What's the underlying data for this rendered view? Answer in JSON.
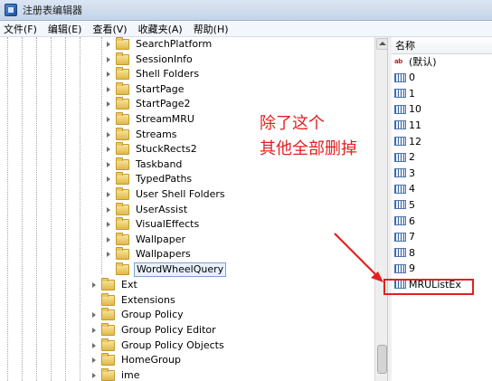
{
  "window": {
    "title": "注册表编辑器"
  },
  "menu": [
    "文件(F)",
    "编辑(E)",
    "查看(V)",
    "收藏夹(A)",
    "帮助(H)"
  ],
  "tree": {
    "child_items": [
      "SearchPlatform",
      "SessionInfo",
      "Shell Folders",
      "StartPage",
      "StartPage2",
      "StreamMRU",
      "Streams",
      "StuckRects2",
      "Taskband",
      "TypedPaths",
      "User Shell Folders",
      "UserAssist",
      "VisualEffects",
      "Wallpaper",
      "Wallpapers",
      "WordWheelQuery"
    ],
    "selected": "WordWheelQuery",
    "parent_items": [
      "Ext",
      "Extensions",
      "Group Policy",
      "Group Policy Editor",
      "Group Policy Objects",
      "HomeGroup",
      "ime"
    ]
  },
  "values": {
    "header": "名称",
    "items": [
      {
        "name": "(默认)",
        "type": "string"
      },
      {
        "name": "0",
        "type": "binary"
      },
      {
        "name": "1",
        "type": "binary"
      },
      {
        "name": "10",
        "type": "binary"
      },
      {
        "name": "11",
        "type": "binary"
      },
      {
        "name": "12",
        "type": "binary"
      },
      {
        "name": "2",
        "type": "binary"
      },
      {
        "name": "3",
        "type": "binary"
      },
      {
        "name": "4",
        "type": "binary"
      },
      {
        "name": "5",
        "type": "binary"
      },
      {
        "name": "6",
        "type": "binary"
      },
      {
        "name": "7",
        "type": "binary"
      },
      {
        "name": "8",
        "type": "binary"
      },
      {
        "name": "9",
        "type": "binary"
      },
      {
        "name": "MRUListEx",
        "type": "binary"
      }
    ]
  },
  "annotation": {
    "line1": "除了这个",
    "line2": "其他全部删掉",
    "color": "#e22020"
  },
  "icons": {
    "app": "registry-icon",
    "folder": "folder-icon",
    "binary_value": "binary-value-icon",
    "string_value": "string-value-icon",
    "expander": "expand-arrow-icon"
  }
}
